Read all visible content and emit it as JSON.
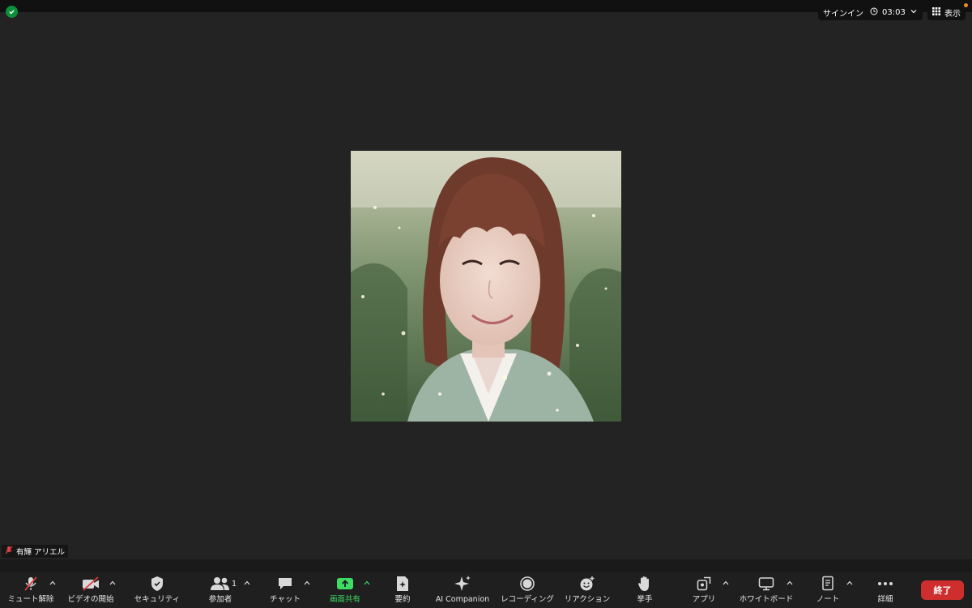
{
  "top_bar": {
    "sign_in": "サインイン",
    "timer": "03:03",
    "view_label": "表示",
    "security_status_color": "#0e8f3a",
    "notification_dot_color": "#f08a24"
  },
  "participant": {
    "name": "有輝 アリエル",
    "muted": true
  },
  "toolbar": {
    "items": [
      {
        "label": "ミュート解除",
        "icon": "muted-mic-icon"
      },
      {
        "label": "ビデオの開始",
        "icon": "video-off-icon"
      },
      {
        "label": "セキュリティ",
        "icon": "shield-icon"
      },
      {
        "label": "参加者",
        "icon": "participants-icon",
        "count": "1"
      },
      {
        "label": "チャット",
        "icon": "chat-icon"
      },
      {
        "label": "画面共有",
        "icon": "share-screen-icon"
      },
      {
        "label": "要約",
        "icon": "summary-icon"
      },
      {
        "label": "AI Companion",
        "icon": "sparkle-icon"
      },
      {
        "label": "レコーディング",
        "icon": "record-icon"
      },
      {
        "label": "リアクション",
        "icon": "reaction-icon"
      },
      {
        "label": "挙手",
        "icon": "raise-hand-icon"
      },
      {
        "label": "アプリ",
        "icon": "apps-icon"
      },
      {
        "label": "ホワイトボード",
        "icon": "whiteboard-icon"
      },
      {
        "label": "ノート",
        "icon": "notes-icon"
      },
      {
        "label": "詳細",
        "icon": "more-icon"
      }
    ],
    "end_label": "終了",
    "accent_green": "#3ddc65",
    "end_color": "#cf2e2e"
  }
}
